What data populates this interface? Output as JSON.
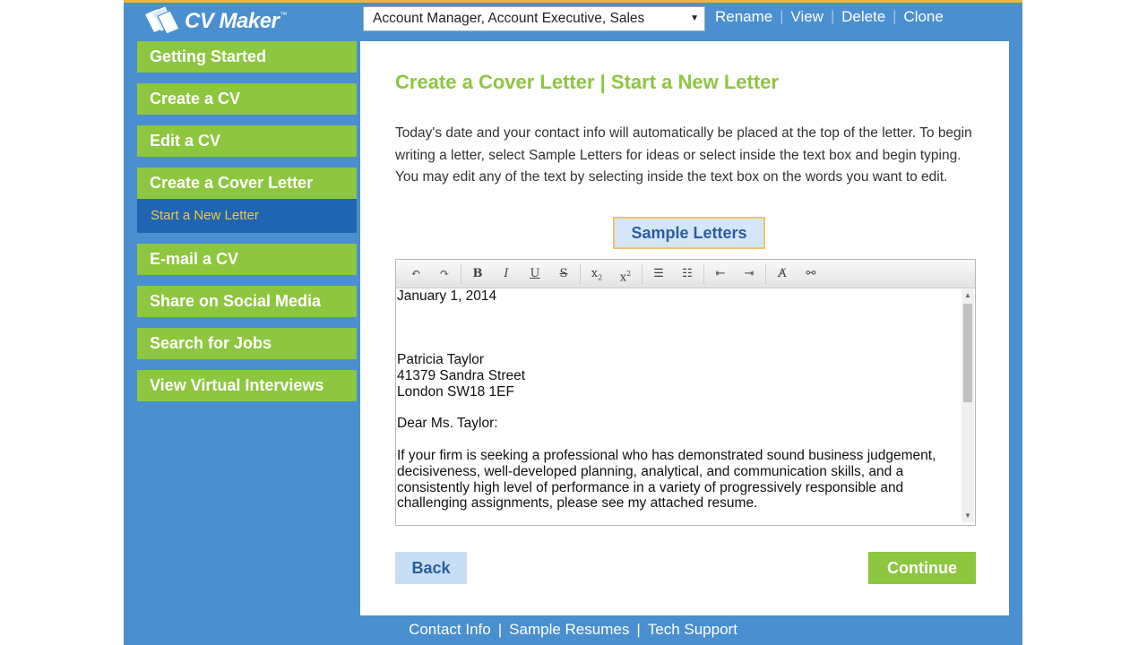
{
  "app": {
    "name": "CV Maker",
    "tm": "™"
  },
  "document_select": {
    "value": "Account Manager, Account Executive, Sales"
  },
  "top_actions": [
    "Rename",
    "View",
    "Delete",
    "Clone"
  ],
  "sidebar": {
    "items": [
      {
        "label": "Getting Started"
      },
      {
        "label": "Create a CV"
      },
      {
        "label": "Edit a CV"
      },
      {
        "label": "Create a Cover Letter",
        "active": true,
        "sub": "Start a New Letter"
      },
      {
        "label": "E-mail a CV"
      },
      {
        "label": "Share on Social Media"
      },
      {
        "label": "Search for Jobs"
      },
      {
        "label": "View Virtual Interviews"
      }
    ]
  },
  "main": {
    "title": "Create a Cover Letter | Start a New Letter",
    "description": "Today's date and your contact info will automatically be placed at the top of the letter. To begin writing a letter, select Sample Letters for ideas or select inside the text box and begin typing. You may edit any of the text by selecting inside the text box on the words you want to edit.",
    "sample_button": "Sample Letters",
    "toolbar_icons": [
      "undo-icon",
      "redo-icon",
      "bold-icon",
      "italic-icon",
      "underline-icon",
      "strikethrough-icon",
      "subscript-icon",
      "superscript-icon",
      "numbered-list-icon",
      "bullet-list-icon",
      "outdent-icon",
      "indent-icon",
      "remove-format-icon",
      "unlink-icon"
    ],
    "letter": {
      "date": "January 1, 2014",
      "name": "Patricia Taylor",
      "street": "41379 Sandra Street",
      "city": "London SW18 1EF",
      "greeting": "Dear Ms. Taylor:",
      "body": "If your firm is seeking a professional who has demonstrated sound business judgement, decisiveness, well-developed planning, analytical, and communication skills, and a consistently high level of performance in a variety of progressively responsible and challenging assignments, please see my attached resume."
    },
    "back_button": "Back",
    "continue_button": "Continue"
  },
  "footer": {
    "links": [
      "Contact Info",
      "Sample Resumes",
      "Tech Support"
    ],
    "separator": "|"
  },
  "colors": {
    "brand_blue": "#4a8fd0",
    "nav_green": "#8dc63f",
    "active_sub": "#1f65b1",
    "sub_text": "#f5c542"
  }
}
